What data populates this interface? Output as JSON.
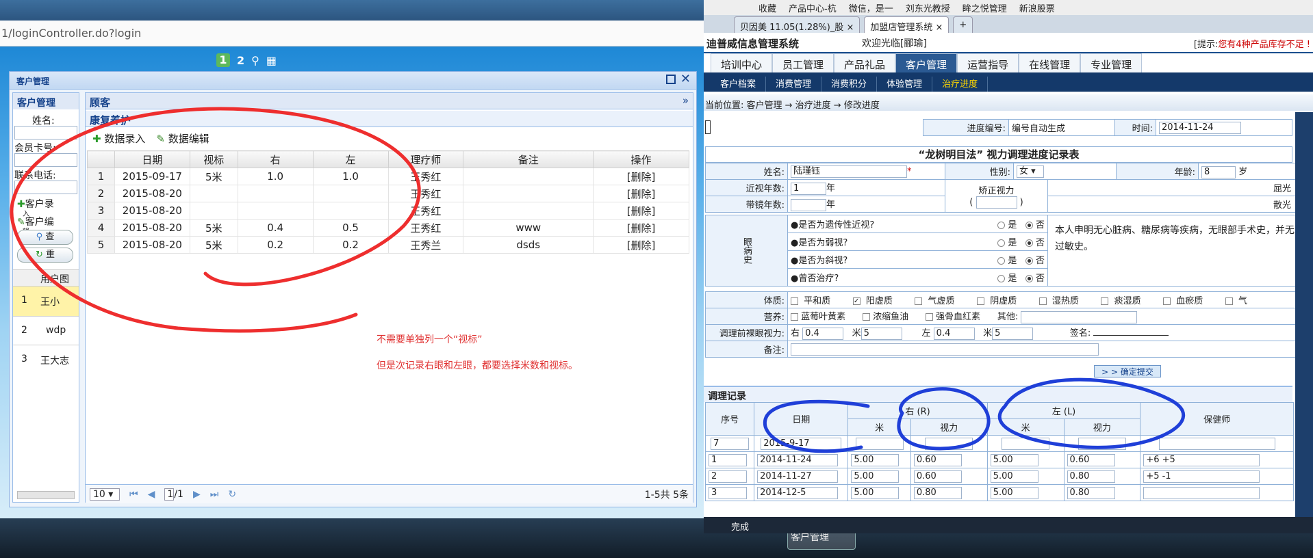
{
  "left": {
    "address": "1/loginController.do?login",
    "icon_one": "1",
    "icon_two": "2",
    "window_title": "客户管理",
    "filter": {
      "title": "客户管理",
      "name_label": "姓名:",
      "card_label": "会员卡号:",
      "phone_label": "联系电话:",
      "add_label": "客户录",
      "add_label2": "入",
      "edit_label": "客户编",
      "edit_label2": "辑",
      "search_label": "查",
      "reset_label": "重",
      "col_label": "用户图"
    },
    "left_rows": [
      {
        "n": "1",
        "v": "王小"
      },
      {
        "n": "2",
        "v": "wdp"
      },
      {
        "n": "3",
        "v": "王大志"
      }
    ],
    "main": {
      "title": "顾客",
      "sub_title": "康复养护",
      "add_btn": "数据录入",
      "edit_btn": "数据编辑",
      "columns": [
        "",
        "日期",
        "视标",
        "右",
        "左",
        "理疗师",
        "备注",
        "操作"
      ],
      "rows": [
        [
          "1",
          "2015-09-17",
          "5米",
          "1.0",
          "1.0",
          "王秀红",
          "",
          "[删除]"
        ],
        [
          "2",
          "2015-08-20",
          "",
          "",
          "",
          "王秀红",
          "",
          "[删除]"
        ],
        [
          "3",
          "2015-08-20",
          "",
          "",
          "",
          "王秀红",
          "",
          "[删除]"
        ],
        [
          "4",
          "2015-08-20",
          "5米",
          "0.4",
          "0.5",
          "王秀红",
          "www",
          "[删除]"
        ],
        [
          "5",
          "2015-08-20",
          "5米",
          "0.2",
          "0.2",
          "王秀兰",
          "dsds",
          "[删除]"
        ]
      ]
    },
    "pager": {
      "size": "10",
      "page": "1",
      "total": "/1",
      "info": "1-5共 5条"
    },
    "note1": "不需要单独列一个“视标”",
    "note2": "但是次记录右眼和左眼，都要选择米数和视标。",
    "taskbar_item": "客户管理"
  },
  "right": {
    "favorites": [
      "收藏",
      "产品中心-杭",
      "微信，是一",
      "刘东光教授",
      "眸之悦管理",
      "新浪股票"
    ],
    "tabs": [
      "贝因美 11.05(1.28%)_股",
      "加盟店管理系统"
    ],
    "system_name": "迪普威信息管理系统",
    "welcome": "欢迎光临[郦瑜]",
    "tip_prefix": "[提示:",
    "tip": "您有4种产品库存不足 !",
    "nav": [
      "培训中心",
      "员工管理",
      "产品礼品",
      "客户管理",
      "运营指导",
      "在线管理",
      "专业管理"
    ],
    "subnav": [
      "客户档案",
      "消费管理",
      "消费积分",
      "体验管理",
      "治疗进度"
    ],
    "breadcrumb": "当前位置: 客户管理 → 治疗进度 → 修改进度",
    "form": {
      "code_label": "进度编号:",
      "code_value": "编号自动生成",
      "time_label": "时间:",
      "time_value": "2014-11-24",
      "title": "“龙树明目法” 视力调理进度记录表",
      "name_label": "姓名:",
      "name_value": "陆瑾钰",
      "gender_label": "性别:",
      "gender_value": "女",
      "age_label": "年龄:",
      "age_value": "8",
      "age_unit": "岁",
      "myopia_label": "近视年数:",
      "myopia_value": "1",
      "year_unit": "年",
      "glasses_label": "带镜年数:",
      "corrected_label": "矫正视力",
      "refract1": "屈光（球镜",
      "refract2": "散光（柱镜",
      "eye_history": "眼病史",
      "questions": [
        "●是否为遗传性近视?",
        "●是否为弱视?",
        "●是否为斜视?",
        "●曾否治疗?"
      ],
      "yes": "是",
      "no": "否",
      "statement": "本人申明无心脏病、糖尿病等疾病，无眼部手术史，并无药物过敏史。",
      "constitution_label": "体质:",
      "constitutions": [
        "平和质",
        "阳虚质",
        "气虚质",
        "阴虚质",
        "湿热质",
        "痰湿质",
        "血瘀质",
        "气"
      ],
      "nutrition_label": "营养:",
      "nutritions": [
        "蓝莓叶黄素",
        "浓缩鱼油",
        "强骨血红素"
      ],
      "other_label": "其他:",
      "pre_label": "调理前裸眼视力:",
      "right_l": "右",
      "left_l": "左",
      "meter": "米",
      "pre_values": {
        "r_vision": "0.4",
        "r_meter": "5",
        "l_vision": "0.4",
        "l_meter": "5"
      },
      "sign_label": "签名:",
      "memo_label": "备注:",
      "submit": "> > 确定提交"
    },
    "record": {
      "title": "调理记录",
      "headers": {
        "seq": "序号",
        "date": "日期",
        "right": "右 (R)",
        "left": "左 (L)",
        "meter": "米",
        "vision": "视力",
        "doctor": "保健师"
      },
      "new_row": {
        "seq": "7",
        "date": "2015-9-17"
      },
      "rows": [
        {
          "seq": "1",
          "date": "2014-11-24",
          "rm": "5.00",
          "rv": "0.60",
          "lm": "5.00",
          "lv": "0.60",
          "doc": "+6  +5"
        },
        {
          "seq": "2",
          "date": "2014-11-27",
          "rm": "5.00",
          "rv": "0.60",
          "lm": "5.00",
          "lv": "0.80",
          "doc": "+5  -1"
        },
        {
          "seq": "3",
          "date": "2014-12-5",
          "rm": "5.00",
          "rv": "0.80",
          "lm": "5.00",
          "lv": "0.80",
          "doc": ""
        }
      ]
    },
    "status": "完成"
  }
}
